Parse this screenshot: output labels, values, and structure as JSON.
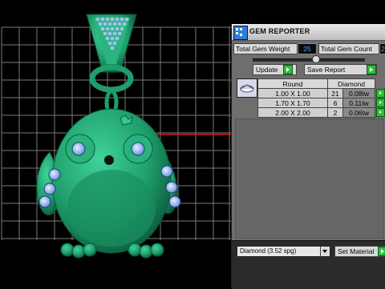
{
  "panel": {
    "title": "GEM REPORTER",
    "total_gem_weight_label": "Total Gem Weight",
    "total_gem_weight_value": "25",
    "total_gem_count_label": "Total Gem Count",
    "total_gem_count_value": "2",
    "update_label": "Update",
    "save_report_label": "Save Report",
    "table": {
      "headers": [
        "Round",
        "Diamond"
      ],
      "rows": [
        {
          "size": "1.00 X 1.00",
          "count": "21",
          "weight": "0.08tw"
        },
        {
          "size": "1.70 X 1.70",
          "count": "6",
          "weight": "0.11tw"
        },
        {
          "size": "2.00 X 2.00",
          "count": "2",
          "weight": "0.06tw"
        }
      ]
    },
    "material_select": "Diamond    (3.52 spg)",
    "set_material_label": "Set Material"
  },
  "colors": {
    "model_green": "#1f9e6b",
    "gem_blue": "#8fb6ee",
    "accent_green": "#29c234",
    "value_blue": "#4aa3ff"
  }
}
